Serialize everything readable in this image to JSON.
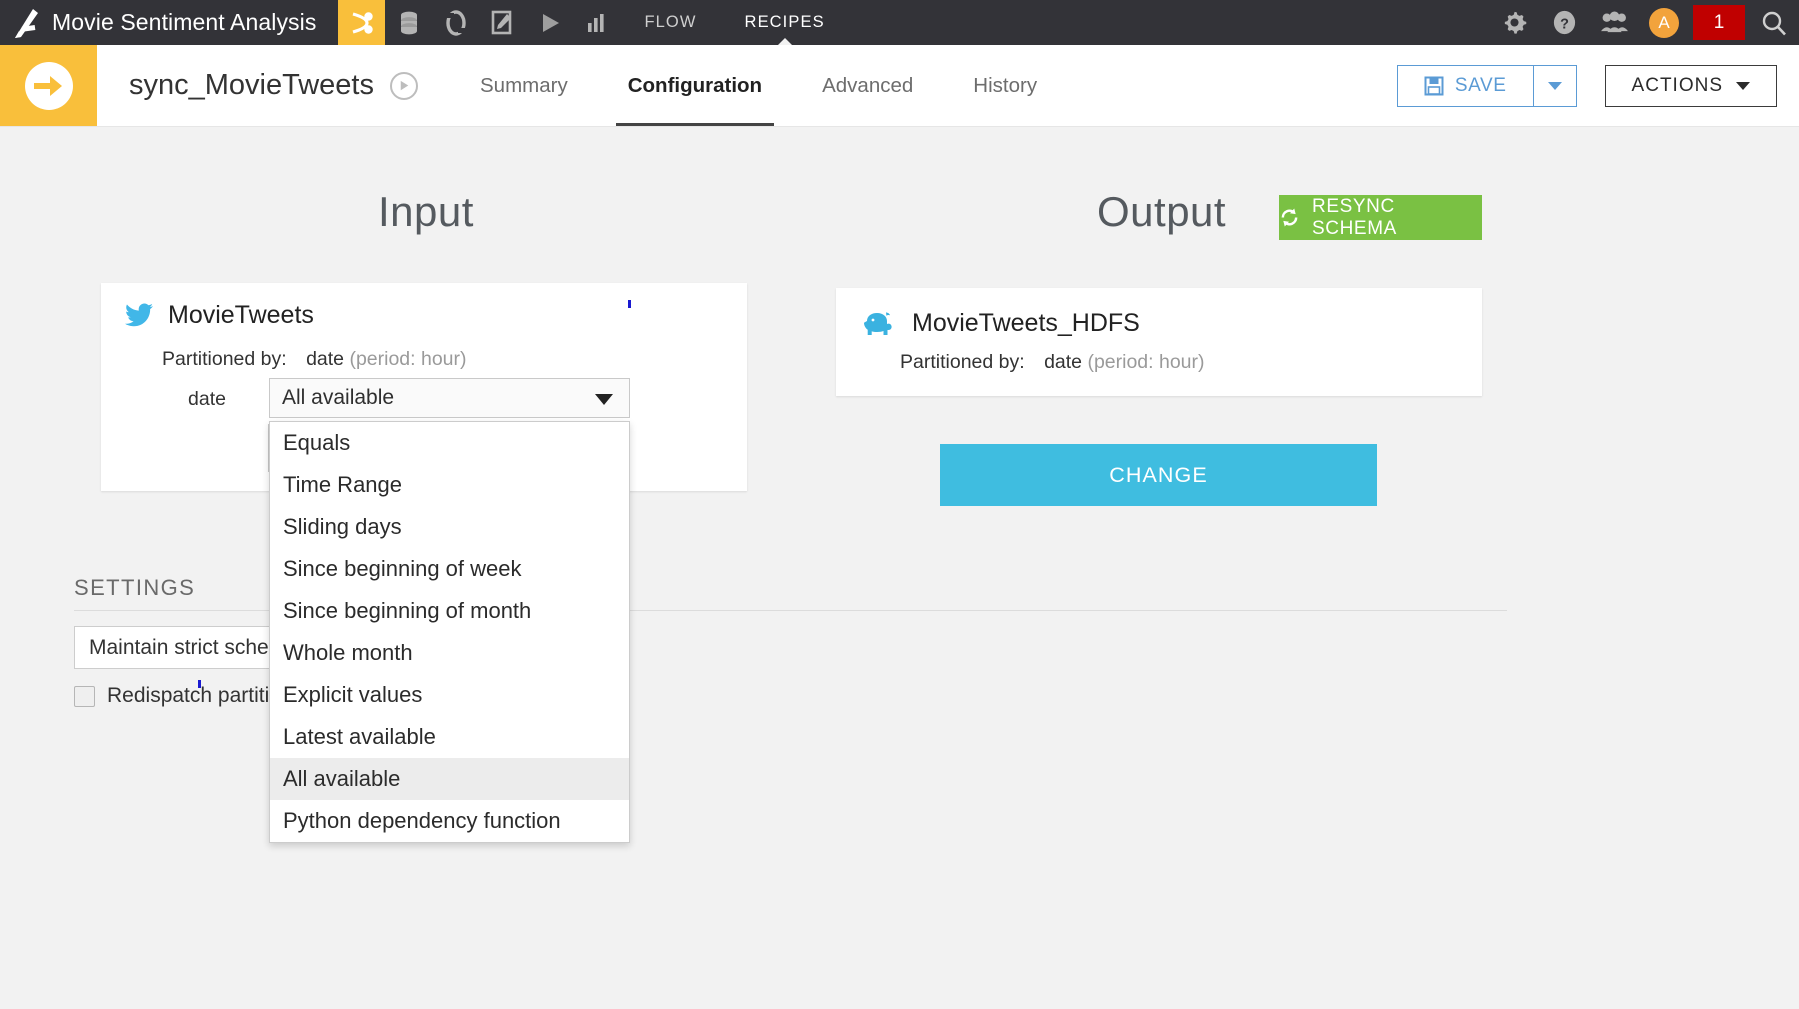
{
  "topbar": {
    "logo_icon": "dataiku-logo-icon",
    "project_title": "Movie Sentiment Analysis",
    "icons": [
      {
        "name": "flow-recipe-icon",
        "label": "",
        "active": true
      },
      {
        "name": "database-icon",
        "label": "",
        "active": false
      },
      {
        "name": "lab-icon",
        "label": "",
        "active": false
      },
      {
        "name": "notebook-edit-icon",
        "label": "",
        "active": false
      },
      {
        "name": "run-play-icon",
        "label": "",
        "active": false
      },
      {
        "name": "chart-bars-icon",
        "label": "",
        "active": false
      }
    ],
    "flow_label": "FLOW",
    "recipes_label": "RECIPES",
    "gear_icon": "gear-icon",
    "help_icon": "help-question-icon",
    "users_icon": "users-group-icon",
    "avatar_letter": "A",
    "notification_count": "1",
    "search_icon": "search-icon"
  },
  "subbar": {
    "recipe_type_icon": "sync-arrow-icon",
    "recipe_name": "sync_MovieTweets",
    "zone_icon": "zone-badge-icon",
    "tabs": [
      {
        "label": "Summary",
        "active": false
      },
      {
        "label": "Configuration",
        "active": true
      },
      {
        "label": "Advanced",
        "active": false
      },
      {
        "label": "History",
        "active": false
      }
    ],
    "save_label": "SAVE",
    "save_icon": "floppy-disk-icon",
    "save_caret_icon": "chevron-down-icon",
    "actions_label": "ACTIONS",
    "actions_caret_icon": "chevron-down-icon"
  },
  "main": {
    "input_title": "Input",
    "output_title": "Output",
    "resync_label": "RESYNC SCHEMA",
    "resync_icon": "refresh-sync-icon",
    "change_label": "CHANGE",
    "input_dataset": {
      "icon": "twitter-bird-icon",
      "name": "MovieTweets",
      "partitioned_label": "Partitioned by:",
      "partition_col": "date",
      "partition_period": "(period: hour)",
      "dimension_label": "date",
      "selected_value": "All available"
    },
    "output_dataset": {
      "icon": "hadoop-elephant-icon",
      "name": "MovieTweets_HDFS",
      "partitioned_label": "Partitioned by:",
      "partition_col": "date",
      "partition_period": "(period: hour)"
    },
    "dropdown_options": [
      {
        "label": "Equals",
        "selected": false
      },
      {
        "label": "Time Range",
        "selected": false
      },
      {
        "label": "Sliding days",
        "selected": false
      },
      {
        "label": "Since beginning of week",
        "selected": false
      },
      {
        "label": "Since beginning of month",
        "selected": false
      },
      {
        "label": "Whole month",
        "selected": false
      },
      {
        "label": "Explicit values",
        "selected": false
      },
      {
        "label": "Latest available",
        "selected": false
      },
      {
        "label": "All available",
        "selected": true
      },
      {
        "label": "Python dependency function",
        "selected": false
      }
    ]
  },
  "settings": {
    "heading": "SETTINGS",
    "schema_mode_value": "Maintain strict schema",
    "redispatch_label": "Redispatch partitioning according to input columns",
    "redispatch_checked": false
  },
  "colors": {
    "topbar_bg": "#333338",
    "accent_yellow": "#f9bf3b",
    "save_blue": "#5b9bd5",
    "resync_green": "#7ac143",
    "change_blue": "#3fbde0",
    "notif_red": "#c00000",
    "twitter_blue": "#41b7e8",
    "hadoop_blue": "#3ab2e0",
    "canvas_bg": "#f2f2f2"
  }
}
